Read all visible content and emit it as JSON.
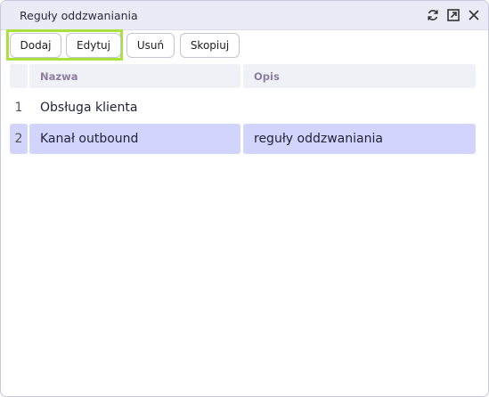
{
  "window": {
    "title": "Reguły oddzwaniania",
    "icons": [
      "refresh-icon",
      "popout-icon",
      "close-icon"
    ]
  },
  "toolbar": {
    "add_label": "Dodaj",
    "edit_label": "Edytuj",
    "delete_label": "Usuń",
    "copy_label": "Skopiuj"
  },
  "table": {
    "columns": [
      "Nazwa",
      "Opis"
    ],
    "rows": [
      {
        "num": "1",
        "name": "Obsługa klienta",
        "desc": "",
        "selected": false
      },
      {
        "num": "2",
        "name": "Kanał outbound",
        "desc": "reguły oddzwaniania",
        "selected": true
      }
    ]
  },
  "colors": {
    "highlight": "#a9e23c",
    "selected_row": "#d2d4fb",
    "titlebar": "#ebebf7",
    "header_text": "#8a7fa3"
  }
}
